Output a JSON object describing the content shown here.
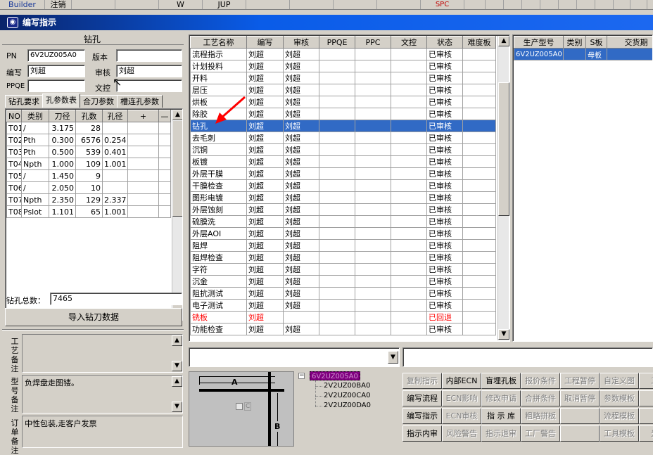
{
  "toolbar": {
    "items": [
      "Builder",
      "注销",
      "",
      "",
      "W",
      "JUP",
      "",
      "",
      "",
      "",
      "SPC",
      "",
      "",
      "",
      "",
      "",
      "",
      "",
      "",
      "",
      "",
      ""
    ]
  },
  "window": {
    "title": "编写指示"
  },
  "drill": {
    "heading": "钻孔",
    "pn_label": "PN",
    "pn_value": "6V2UZ005A0",
    "version_label": "版本",
    "version_value": "",
    "writer_label": "编写",
    "writer_value": "刘超",
    "reviewer_label": "审核",
    "reviewer_value": "刘超",
    "ppqe_label": "PPQE",
    "ppqe_value": "",
    "wenkong_label": "文控",
    "wenkong_value": "",
    "tabs": [
      "钻孔要求",
      "孔参数表",
      "合刀参数",
      "槽连孔参数"
    ],
    "columns": [
      "NO",
      "类别",
      "刀径",
      "孔数",
      "孔径",
      "+",
      "—"
    ],
    "rows": [
      [
        "T01",
        "/",
        "3.175",
        "28",
        ""
      ],
      [
        "T02",
        "Pth",
        "0.300",
        "6576",
        "0.254"
      ],
      [
        "T03",
        "Pth",
        "0.500",
        "539",
        "0.401"
      ],
      [
        "T04",
        "Npth",
        "1.000",
        "109",
        "1.001"
      ],
      [
        "T05",
        "/",
        "1.450",
        "9",
        ""
      ],
      [
        "T06",
        "/",
        "2.050",
        "10",
        ""
      ],
      [
        "T07",
        "Npth",
        "2.350",
        "129",
        "2.337"
      ],
      [
        "T08",
        "Pslot",
        "1.101",
        "65",
        "1.001"
      ]
    ],
    "total_label": "钻孔总数：",
    "total_value": "7465",
    "import_button": "导入钻刀数据"
  },
  "notes": {
    "process_label": "工艺备注",
    "process_value": "",
    "model_label": "型号备注",
    "model_value": "负焊盘走图镂。",
    "order_label": "订单备注",
    "order_value": "中性包装,走客户发票"
  },
  "process": {
    "columns": [
      "工艺名称",
      "编写",
      "审核",
      "PPQE",
      "PPC",
      "文控",
      "状态",
      "难度板"
    ],
    "selected_index": 6,
    "rows": [
      {
        "name": "流程指示",
        "writer": "刘超",
        "reviewer": "刘超",
        "status": "已审核"
      },
      {
        "name": "计划投料",
        "writer": "刘超",
        "reviewer": "刘超",
        "status": "已审核"
      },
      {
        "name": "开料",
        "writer": "刘超",
        "reviewer": "刘超",
        "status": "已审核"
      },
      {
        "name": "层压",
        "writer": "刘超",
        "reviewer": "刘超",
        "status": "已审核"
      },
      {
        "name": "烘板",
        "writer": "刘超",
        "reviewer": "刘超",
        "status": "已审核"
      },
      {
        "name": "除胶",
        "writer": "刘超",
        "reviewer": "刘超",
        "status": "已审核"
      },
      {
        "name": "钻孔",
        "writer": "刘超",
        "reviewer": "刘超",
        "status": "已审核"
      },
      {
        "name": "去毛刺",
        "writer": "刘超",
        "reviewer": "刘超",
        "status": "已审核"
      },
      {
        "name": "沉铜",
        "writer": "刘超",
        "reviewer": "刘超",
        "status": "已审核"
      },
      {
        "name": "板镀",
        "writer": "刘超",
        "reviewer": "刘超",
        "status": "已审核"
      },
      {
        "name": "外层干膜",
        "writer": "刘超",
        "reviewer": "刘超",
        "status": "已审核"
      },
      {
        "name": "干膜检查",
        "writer": "刘超",
        "reviewer": "刘超",
        "status": "已审核"
      },
      {
        "name": "图形电镀",
        "writer": "刘超",
        "reviewer": "刘超",
        "status": "已审核"
      },
      {
        "name": "外层蚀刻",
        "writer": "刘超",
        "reviewer": "刘超",
        "status": "已审核"
      },
      {
        "name": "硫膜洗",
        "writer": "刘超",
        "reviewer": "刘超",
        "status": "已审核"
      },
      {
        "name": "外层AOI",
        "writer": "刘超",
        "reviewer": "刘超",
        "status": "已审核"
      },
      {
        "name": "阻焊",
        "writer": "刘超",
        "reviewer": "刘超",
        "status": "已审核"
      },
      {
        "name": "阻焊检查",
        "writer": "刘超",
        "reviewer": "刘超",
        "status": "已审核"
      },
      {
        "name": "字符",
        "writer": "刘超",
        "reviewer": "刘超",
        "status": "已审核"
      },
      {
        "name": "沉金",
        "writer": "刘超",
        "reviewer": "刘超",
        "status": "已审核"
      },
      {
        "name": "阻抗测试",
        "writer": "刘超",
        "reviewer": "刘超",
        "status": "已审核"
      },
      {
        "name": "电子测试",
        "writer": "刘超",
        "reviewer": "刘超",
        "status": "已审核"
      },
      {
        "name": "铣板",
        "writer": "刘超",
        "reviewer": "",
        "status": "已回退",
        "red": true
      },
      {
        "name": "功能检查",
        "writer": "刘超",
        "reviewer": "刘超",
        "status": "已审核"
      }
    ]
  },
  "production": {
    "columns": [
      "生产型号",
      "类别",
      "S板",
      "交货期"
    ],
    "rows": [
      [
        "6V2UZ005A0",
        "",
        "母板",
        ""
      ]
    ]
  },
  "diagram": {
    "label_a": "A",
    "label_b": "B",
    "label_c": "C"
  },
  "tree": {
    "root": "6V2UZ005A0",
    "children": [
      "2V2UZ00BA0",
      "2V2UZ00CA0",
      "2V2UZ00DA0"
    ]
  },
  "buttons": [
    [
      {
        "t": "复制指示",
        "d": true
      },
      {
        "t": "内部ECN",
        "d": false
      },
      {
        "t": "盲埋孔板",
        "d": false
      },
      {
        "t": "报价条件",
        "d": true
      },
      {
        "t": "工程暂停",
        "d": true
      },
      {
        "t": "自定义图",
        "d": true
      },
      {
        "t": "工艺",
        "d": true
      }
    ],
    [
      {
        "t": "编写流程",
        "d": false
      },
      {
        "t": "ECN影响",
        "d": true
      },
      {
        "t": "修改申请",
        "d": true
      },
      {
        "t": "合拼条件",
        "d": true
      },
      {
        "t": "取消暂停",
        "d": true
      },
      {
        "t": "参数模板",
        "d": true
      },
      {
        "t": "",
        "d": true
      }
    ],
    [
      {
        "t": "编写指示",
        "d": false
      },
      {
        "t": "ECN审核",
        "d": true
      },
      {
        "t": "指 示 库",
        "d": false
      },
      {
        "t": "粗略拼板",
        "d": true
      },
      {
        "t": "",
        "d": true
      },
      {
        "t": "流程模板",
        "d": true
      },
      {
        "t": "",
        "d": true
      }
    ],
    [
      {
        "t": "指示内审",
        "d": false
      },
      {
        "t": "风险警告",
        "d": true
      },
      {
        "t": "指示退审",
        "d": true
      },
      {
        "t": "工厂警告",
        "d": true
      },
      {
        "t": "",
        "d": true
      },
      {
        "t": "工具模板",
        "d": true
      },
      {
        "t": "光绘",
        "d": true
      }
    ]
  ],
  "colors": {
    "title_bar": "#0a5ce8",
    "selection": "#316ac5",
    "rejected": "#ff0000",
    "tree_highlight": "#800080",
    "arrow": "#ff0000"
  }
}
